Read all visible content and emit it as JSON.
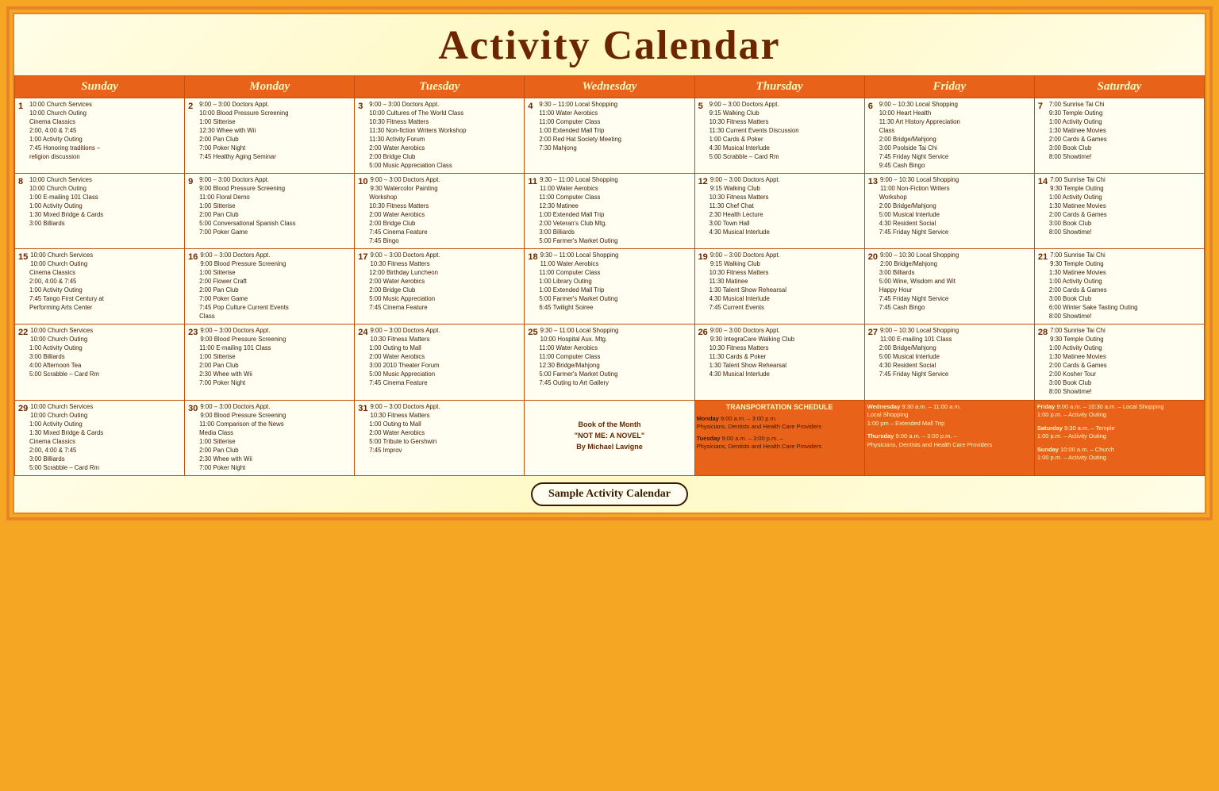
{
  "title": "Activity Calendar",
  "days": [
    "Sunday",
    "Monday",
    "Tuesday",
    "Wednesday",
    "Thursday",
    "Friday",
    "Saturday"
  ],
  "footer": "Sample Activity Calendar",
  "weeks": [
    {
      "cells": [
        {
          "num": "1",
          "content": [
            "10:00 Church Services",
            "10:00 Church Outing",
            "Cinema Classics",
            "2:00, 4:00 & 7:45",
            "1:00 Activity Outing",
            "7:45 Honoring traditions – religion discussion"
          ]
        },
        {
          "num": "2",
          "content": [
            "9:00 – 3:00 Doctors Appt.",
            "10:00 Blood Pressure Screening",
            "1:00 Sitterise",
            "12:30 Whee with Wii",
            "2:00 Pan Club",
            "7:00 Poker Night",
            "7:45 Healthy Aging Seminar"
          ]
        },
        {
          "num": "3",
          "content": [
            "9:00 – 3:00 Doctors Appt.",
            "10:00 Cultures of The World Class",
            "10:30 Fitness Matters",
            "11:30 Non-fiction Writers Workshop",
            "11:30 Activity Forum",
            "2:00 Water Aerobics",
            "2:00 Bridge Club",
            "5:00 Music Appreciation Class"
          ]
        },
        {
          "num": "4",
          "content": [
            "9:30 – 11:00 Local Shopping",
            "11:00 Water Aerobics",
            "11:00 Computer Class",
            "1:00 Extended Mall Trip",
            "2:00 Red Hat Society Meeting",
            "7:30 Mahjong"
          ]
        },
        {
          "num": "5",
          "content": [
            "9:00 – 3:00 Doctors Appt.",
            "9:15 Walking Club",
            "10:30 Fitness Matters",
            "11:30 Current Events Discussion",
            "1:00 Cards & Poker",
            "4:30 Musical Interlude",
            "5:00 Scrabble – Card Rm"
          ]
        },
        {
          "num": "6",
          "content": [
            "9:00 – 10:30 Local Shopping",
            "10:00 Heart Health",
            "11:30 Art History Appreciation Class",
            "2:00 Bridge/Mahjong",
            "3:00 Poolside Tai Chi",
            "7:45 Friday Night Service",
            "9:45 Cash Bingo"
          ]
        },
        {
          "num": "7",
          "content": [
            "7:00 Sunrise Tai Chi",
            "9:30 Temple Outing",
            "1:00 Activity Outing",
            "1:30 Matinee Movies",
            "2:00 Cards & Games",
            "3:00 Book Club",
            "8:00 Showtime!"
          ]
        }
      ]
    },
    {
      "cells": [
        {
          "num": "8",
          "content": [
            "10:00 Church Services",
            "10:00 Church Outing",
            "1:00 E-mailing 101 Class",
            "1:00 Activity Outing",
            "1:30 Mixed Bridge & Cards",
            "3:00 Billiards"
          ]
        },
        {
          "num": "9",
          "content": [
            "9:00 – 3:00 Doctors Appt.",
            "9:00 Blood Pressure Screening",
            "11:00 Floral Demo",
            "1:00 Sitterise",
            "2:00 Pan Club",
            "5:00 Conversational Spanish Class",
            "7:00 Poker Game"
          ]
        },
        {
          "num": "10",
          "content": [
            "9:00 – 3:00 Doctors Appt.",
            "9:30 Watercolor Painting Workshop",
            "10:30 Fitness Matters",
            "2:00 Water Aerobics",
            "2:00 Bridge Club",
            "7:45 Cinema Feature",
            "7:45 Bingo"
          ]
        },
        {
          "num": "11",
          "content": [
            "9:30 – 11:00 Local Shopping",
            "11:00 Water Aerobics",
            "11:00 Computer Class",
            "12:30 Matinee",
            "1:00 Extended Mall Trip",
            "2:00 Veteran's Club Mtg.",
            "3:00 Billiards",
            "5:00 Farmer's Market Outing"
          ]
        },
        {
          "num": "12",
          "content": [
            "9:00 – 3:00 Doctors Appt.",
            "9:15 Walking Club",
            "10:30 Fitness Matters",
            "11:30 Chef Chat",
            "2:30 Health Lecture",
            "3:00 Town Hall",
            "4:30 Musical Interlude"
          ]
        },
        {
          "num": "13",
          "content": [
            "9:00 – 10:30 Local Shopping",
            "11:00 Non-Fiction Writers Workshop",
            "2:00 Bridge/Mahjong",
            "5:00 Musical Interlude",
            "4:30 Resident Social",
            "7:45 Friday Night Service"
          ]
        },
        {
          "num": "14",
          "content": [
            "7:00 Sunrise Tai Chi",
            "9:30 Temple Outing",
            "1:00 Activity Outing",
            "1:30 Matinee Movies",
            "2:00 Cards & Games",
            "3:00 Book Club",
            "8:00 Showtime!"
          ]
        }
      ]
    },
    {
      "cells": [
        {
          "num": "15",
          "content": [
            "10:00 Church Services",
            "10:00 Church Outing",
            "Cinema Classics",
            "2:00, 4:00 & 7:45",
            "1:00 Activity Outing",
            "7:45 Tango First Century at Performing Arts Center"
          ]
        },
        {
          "num": "16",
          "content": [
            "9:00 – 3:00 Doctors Appt.",
            "9:00 Blood Pressure Screening",
            "1:00 Sitterise",
            "2:00 Flower Craft",
            "2:00 Pan Club",
            "7:00 Poker Game",
            "7:45 Pop Culture Current Events Class"
          ]
        },
        {
          "num": "17",
          "content": [
            "9:00 – 3:00 Doctors Appt.",
            "10:30 Fitness Matters",
            "12:00 Birthday Luncheon",
            "2:00 Water Aerobics",
            "2:00 Bridge Club",
            "5:00 Music Appreciation",
            "7:45 Cinema Feature"
          ]
        },
        {
          "num": "18",
          "content": [
            "9:30 – 11:00 Local Shopping",
            "11:00 Water Aerobics",
            "11:00 Computer Class",
            "1:00 Library Outing",
            "1:00 Extended Mall Trip",
            "5:00 Farmer's Market Outing",
            "6:45 Twilight Soiree"
          ]
        },
        {
          "num": "19",
          "content": [
            "9:00 – 3:00 Doctors Appt.",
            "9:15 Walking Club",
            "10:30 Fitness Matters",
            "11:30 Matinee",
            "1:30 Talent Show Rehearsal",
            "4:30 Musical Interlude",
            "7:45 Current Events"
          ]
        },
        {
          "num": "20",
          "content": [
            "9:00 – 10:30 Local Shopping",
            "2:00 Bridge/Mahjong",
            "3:00 Billiards",
            "5:00 Wine, Wisdom and Wit Happy Hour",
            "7:45 Friday Night Service",
            "7:45 Cash Bingo"
          ]
        },
        {
          "num": "21",
          "content": [
            "7:00 Sunrise Tai Chi",
            "9:30 Temple Outing",
            "1:30 Matinee Movies",
            "1:00 Activity Outing",
            "2:00 Cards & Games",
            "3:00 Book Club",
            "6:00 Winter Sake Tasting Outing",
            "8:00 Showtime!"
          ]
        }
      ]
    },
    {
      "cells": [
        {
          "num": "22",
          "content": [
            "10:00 Church Services",
            "10:00 Church Outing",
            "1:00 Activity Outing",
            "3:00 Billiards",
            "4:00 Afternoon Tea",
            "5:00 Scrabble – Card Rm"
          ]
        },
        {
          "num": "23",
          "content": [
            "9:00 – 3:00 Doctors Appt.",
            "9:00 Blood Pressure Screening",
            "11:00 E-mailing 101 Class",
            "1:00 Sitterise",
            "2:00 Pan Club",
            "2:30 Whee with Wii",
            "7:00 Poker Night"
          ]
        },
        {
          "num": "24",
          "content": [
            "9:00 – 3:00 Doctors Appt.",
            "10:30 Fitness Matters",
            "1:00 Outing to Mall",
            "2:00 Water Aerobics",
            "3:00 2010 Theater Forum",
            "5:00 Music Appreciation",
            "7:45 Cinema Feature"
          ]
        },
        {
          "num": "25",
          "content": [
            "9:30 – 11:00 Local Shopping",
            "10:00 Hospital Aux. Mtg.",
            "11:00 Water Aerobics",
            "11:00 Computer Class",
            "12:30 Bridge/Mahjong",
            "5:00 Farmer's Market Outing",
            "7:45 Outing to Art Gallery"
          ]
        },
        {
          "num": "26",
          "content": [
            "9:00 – 3:00 Doctors Appt.",
            "9:30 IntegraCare Walking Club",
            "10:30 Fitness Matters",
            "11:30 Cards & Poker",
            "1:30 Talent Show Rehearsal",
            "4:30 Musical Interlude"
          ]
        },
        {
          "num": "27",
          "content": [
            "9:00 – 10:30 Local Shopping",
            "11:00 E-mailing 101 Class",
            "2:00 Bridge/Mahjong",
            "5:00 Musical Interlude",
            "4:30 Resident Social",
            "7:45 Friday Night Service"
          ]
        },
        {
          "num": "28",
          "content": [
            "7:00 Sunrise Tai Chi",
            "9:30 Temple Outing",
            "1:00 Activity Outing",
            "1:30 Matinee Movies",
            "2:00 Cards & Games",
            "2:00 Kosher Tour",
            "3:00 Book Club",
            "8:00 Showtime!"
          ]
        }
      ]
    },
    {
      "cells": [
        {
          "num": "29",
          "content": [
            "10:00 Church Services",
            "10:00 Church Outing",
            "1:00 Activity Outing",
            "1:30 Mixed Bridge & Cards",
            "Cinema Classics",
            "2:00, 4:00 & 7:45",
            "3:00 Billiards",
            "5:00 Scrabble – Card Rm"
          ]
        },
        {
          "num": "30",
          "content": [
            "9:00 – 3:00 Doctors Appt.",
            "9:00 Blood Pressure Screening",
            "11:00 Comparison of the News Media Class",
            "1:00 Sitterise",
            "2:00 Pan Club",
            "2:30 Whee with Wii",
            "7:00 Poker Night"
          ]
        },
        {
          "num": "31",
          "content": [
            "9:00 – 3:00 Doctors Appt.",
            "10:30 Fitness Matters",
            "1:00 Outing to Mall",
            "2:00 Water Aerobics",
            "5:00 Tribute to Gershwin",
            "7:45 Improv"
          ]
        },
        {
          "special": "book",
          "content": [
            "Book of the Month",
            "\"NOT ME: A NOVEL\"",
            "By Michael Lavigne"
          ]
        },
        {
          "special": "transport-header",
          "content": []
        },
        {
          "special": "transport-fri",
          "content": []
        },
        {
          "special": "transport-sat",
          "content": []
        }
      ]
    }
  ],
  "transport": {
    "header": "TRANSPORTATION SCHEDULE",
    "monday": "Monday 9:00 a.m. – 3:00 p.m. Physicians, Dentists and Health Care Providers",
    "tuesday": "Tuesday 9:00 a.m. – 3:00 p.m. – Physicians, Dentists and Health Care Providers",
    "wednesday": "Wednesday 9:30 a.m. – 11:00 a.m. Local Shopping\n1:00 pm – Extended Mall Trip",
    "thursday": "Thursday 9:00 a.m. – 3:00 p.m. – Physicians, Dentists and Health Care Providers",
    "friday": "Friday 9:00 a.m. – 10:30 a.m. – Local Shopping\n1:00 p.m. – Activity Outing",
    "saturday": "Saturday 9:30 a.m. – Temple\n1:00 p.m. – Activity Outing",
    "sunday": "Sunday 10:00 a.m. – Church\n1:00 p.m. – Activity Outing"
  }
}
